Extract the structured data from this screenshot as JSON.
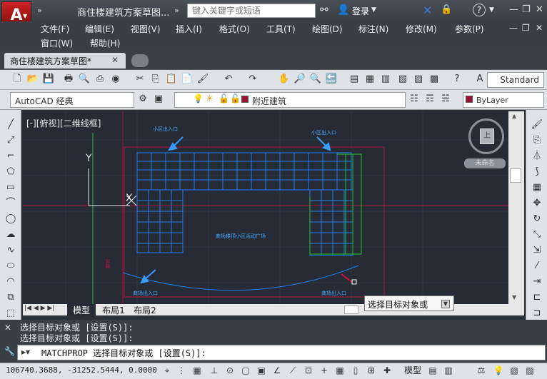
{
  "titlebar": {
    "logo_letter": "A",
    "document_title": "商住楼建筑方案草图...",
    "search_placeholder": "键入关键字或短语",
    "login_label": "登录"
  },
  "menubar": {
    "items": [
      "文件(F)",
      "编辑(E)",
      "视图(V)",
      "插入(I)",
      "格式(O)",
      "工具(T)",
      "绘图(D)",
      "标注(N)",
      "修改(M)",
      "参数(P)",
      "窗口(W)",
      "帮助(H)"
    ]
  },
  "tabs": {
    "active": "商住楼建筑方案草图*"
  },
  "toolbar": {
    "text_style": "Standard",
    "workspace": "AutoCAD 经典",
    "layer_name": "附近建筑",
    "color": "ByLayer",
    "layer_color": "#a01030"
  },
  "canvas": {
    "viewport_label": "[-][俯视][二维线框]",
    "ucs_y": "Y",
    "ucs_x": "X",
    "viewcube_face": "上",
    "unnamed_label": "未命名",
    "entrance_label": "小区出入口",
    "mall_label": "商场出入口",
    "plaza_label": "商场楼顶小区活动广场",
    "left_label": "公路"
  },
  "layout_tabs": [
    "模型",
    "布局1",
    "布局2"
  ],
  "tooltip": {
    "text": "选择目标对象或"
  },
  "command": {
    "history": [
      "选择目标对象或 [设置(S)]:",
      "选择目标对象或 [设置(S)]:"
    ],
    "current": "MATCHPROP 选择目标对象或 [设置(S)]:"
  },
  "status": {
    "coordinates": "106740.3688, -31252.5444, 0.0000",
    "model_label": "模型"
  },
  "colors": {
    "canvas_bg": "#262b35",
    "building_blue": "#1e7ff0",
    "building_green": "#23c42a",
    "boundary_red": "#b0103a"
  }
}
